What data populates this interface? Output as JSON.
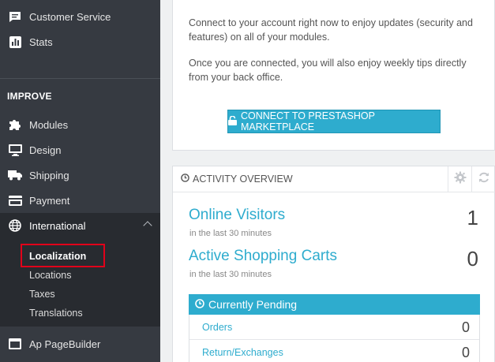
{
  "sidebar": {
    "top_items": [
      {
        "label": "Customer Service",
        "icon": "chat-icon"
      },
      {
        "label": "Stats",
        "icon": "bar-chart-icon"
      }
    ],
    "section_label": "IMPROVE",
    "improve_items": [
      {
        "label": "Modules",
        "icon": "puzzle-icon"
      },
      {
        "label": "Design",
        "icon": "monitor-icon"
      },
      {
        "label": "Shipping",
        "icon": "truck-icon"
      },
      {
        "label": "Payment",
        "icon": "credit-card-icon"
      },
      {
        "label": "International",
        "icon": "globe-icon"
      }
    ],
    "international_subitems": [
      {
        "label": "Localization"
      },
      {
        "label": "Locations"
      },
      {
        "label": "Taxes"
      },
      {
        "label": "Translations"
      }
    ],
    "bottom_item": {
      "label": "Ap PageBuilder",
      "icon": "window-icon"
    }
  },
  "connect_card": {
    "paragraph1": "Connect to your account right now to enjoy updates (security and features) on all of your modules.",
    "paragraph2": "Once you are connected, you will also enjoy weekly tips directly from your back office.",
    "button_label": "CONNECT TO PRESTASHOP MARKETPLACE"
  },
  "activity": {
    "title": "ACTIVITY OVERVIEW",
    "metrics": [
      {
        "label": "Online Visitors",
        "sub": "in the last 30 minutes",
        "value": "1"
      },
      {
        "label": "Active Shopping Carts",
        "sub": "in the last 30 minutes",
        "value": "0"
      }
    ],
    "pending_title": "Currently Pending",
    "pending_rows": [
      {
        "label": "Orders",
        "value": "0"
      },
      {
        "label": "Return/Exchanges",
        "value": "0"
      }
    ]
  },
  "colors": {
    "sidebar_bg": "#363a41",
    "accent": "#2eacce",
    "highlight": "#e2001a"
  }
}
